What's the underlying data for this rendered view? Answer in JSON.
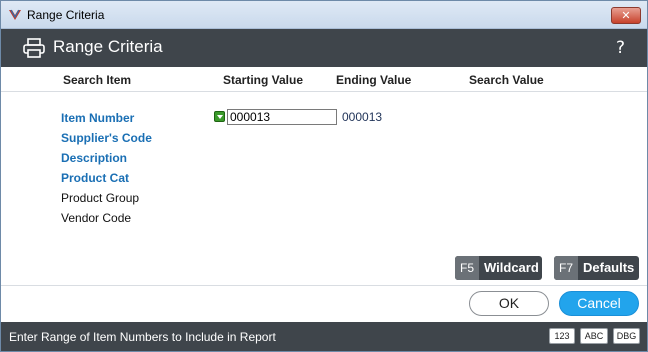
{
  "window": {
    "title": "Range Criteria",
    "close_glyph": "✕"
  },
  "header": {
    "title": "Range Criteria",
    "print_icon": "printer-icon",
    "help_glyph": "?"
  },
  "columns": {
    "search_item": "Search Item",
    "starting_value": "Starting Value",
    "ending_value": "Ending Value",
    "search_value": "Search Value"
  },
  "items": [
    {
      "label": "Item Number",
      "style": "active"
    },
    {
      "label": "Supplier's Code",
      "style": "active"
    },
    {
      "label": "Description",
      "style": "active"
    },
    {
      "label": "Product Cat",
      "style": "active"
    },
    {
      "label": "Product Group",
      "style": "plain"
    },
    {
      "label": "Vendor Code",
      "style": "plain"
    }
  ],
  "range": {
    "starting_value": "000013",
    "ending_value": "000013"
  },
  "fkeys": [
    {
      "key": "F5",
      "label": "Wildcard"
    },
    {
      "key": "F7",
      "label": "Defaults"
    }
  ],
  "buttons": {
    "ok": "OK",
    "cancel": "Cancel"
  },
  "status": {
    "text": "Enter Range of Item Numbers to Include in Report",
    "modes": [
      "123",
      "ABC",
      "DBG"
    ]
  },
  "colors": {
    "accent": "#22a4ec",
    "link_blue": "#1a6fb4",
    "dark_bar": "#3f454b"
  }
}
